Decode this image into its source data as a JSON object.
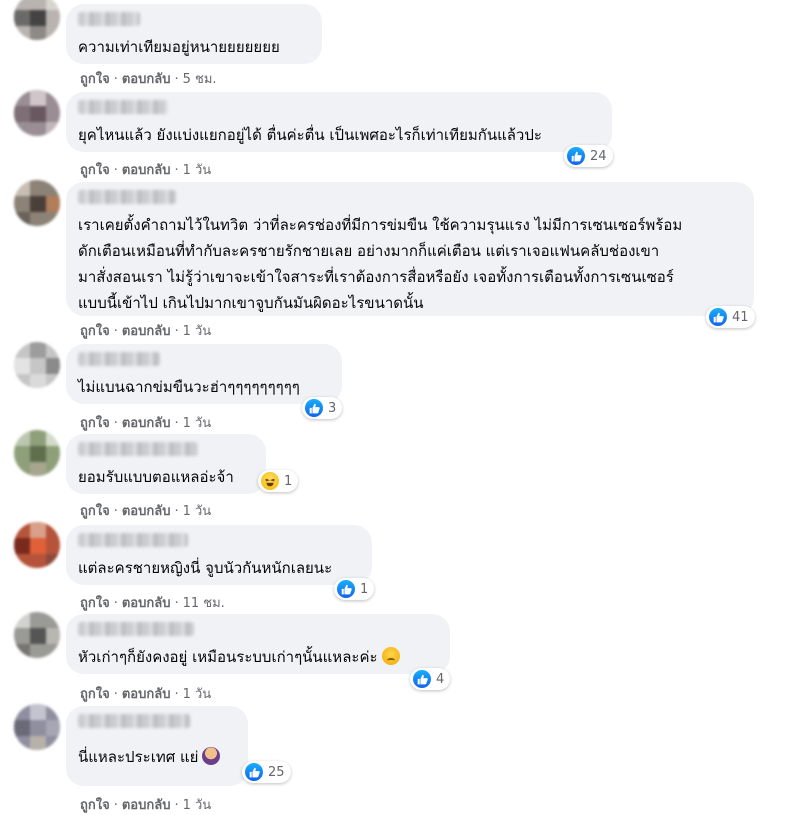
{
  "actions": {
    "like": "ถูกใจ",
    "reply": "ตอบกลับ",
    "separator": "·"
  },
  "comments": [
    {
      "text": "ความเท่าเทียมอยู่หนายยยยยยย",
      "time": "5 ชม.",
      "reaction": null
    },
    {
      "text": "ยุคไหนแล้ว ยังแบ่งแยกอยู่ได้ ตื่นค่ะตื่น เป็นเพศอะไรก็เท่าเทียมกันแล้วปะ",
      "time": "1 วัน",
      "reaction": {
        "type": "like-icon",
        "count": "24"
      }
    },
    {
      "text": "เราเคยตั้งคำถามไว้ในทวิต ว่าที่ละครช่องที่มีการข่มขืน ใช้ความรุนแรง ไม่มีการเซนเซอร์พร้อม\nดักเตือนเหมือนที่ทำกับละครชายรักชายเลย อย่างมากก็แค่เตือน แต่เราเจอแฟนคลับช่องเขา\nมาสั่งสอนเรา ไม่รู้ว่าเขาจะเข้าใจสาระที่เราต้องการสื่อหรือยัง เจอทั้งการเตือนทั้งการเซนเซอร์\nแบบนี้เข้าไป เกินไปมากเขาจูบกันมันผิดอะไรขนาดนั้น",
      "time": "1 วัน",
      "reaction": {
        "type": "like-icon",
        "count": "41"
      }
    },
    {
      "text": "ไม่แบนฉากข่มขืนวะฮ่าๆๆๆๆๆๆๆๆๆ",
      "time": "1 วัน",
      "reaction": {
        "type": "like-icon",
        "count": "3"
      }
    },
    {
      "text": "ยอมรับแบบตอแหลอ่ะจ้า",
      "time": "1 วัน",
      "reaction": {
        "type": "haha-icon",
        "count": "1"
      }
    },
    {
      "text": "แต่ละครชายหญิงนี่ จูบนัวกันหนักเลยนะ",
      "time": "11 ชม.",
      "reaction": {
        "type": "like-icon",
        "count": "1"
      }
    },
    {
      "text": "หัวเก่าๆก็ยังคงอยู่ เหมือนระบบเก่าๆนั้นแหละค่ะ",
      "time": "1 วัน",
      "reaction": {
        "type": "like-icon",
        "count": "4"
      },
      "emoji": "sad-emoji"
    },
    {
      "text": "นี่แหละประเทศ แย่",
      "time": "1 วัน",
      "reaction": {
        "type": "like-icon",
        "count": "25"
      },
      "emoji": "person-gesturing-no-emoji"
    }
  ],
  "colors": {
    "bubble": "#f0f2f5",
    "meta": "#65676b",
    "like": "#1877f2"
  }
}
